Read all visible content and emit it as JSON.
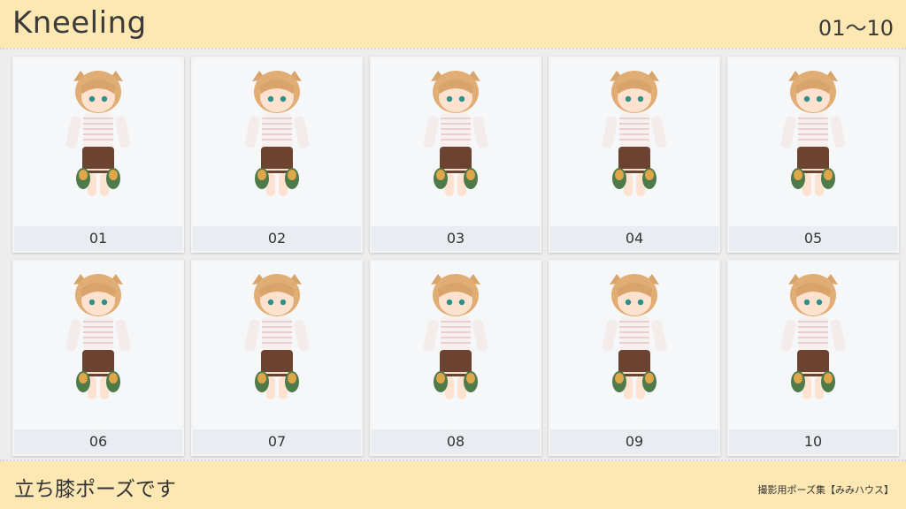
{
  "header": {
    "title": "Kneeling",
    "range": "01〜10"
  },
  "poses": [
    {
      "label": "01"
    },
    {
      "label": "02"
    },
    {
      "label": "03"
    },
    {
      "label": "04"
    },
    {
      "label": "05"
    },
    {
      "label": "06"
    },
    {
      "label": "07"
    },
    {
      "label": "08"
    },
    {
      "label": "09"
    },
    {
      "label": "10"
    }
  ],
  "footer": {
    "subtitle": "立ち膝ポーズです",
    "credit": "撮影用ポーズ集【みみハウス】"
  },
  "colors": {
    "band": "#fde7b3",
    "panel": "#ededed",
    "card": "#ffffff",
    "caption_bg": "#e9ecf0"
  }
}
